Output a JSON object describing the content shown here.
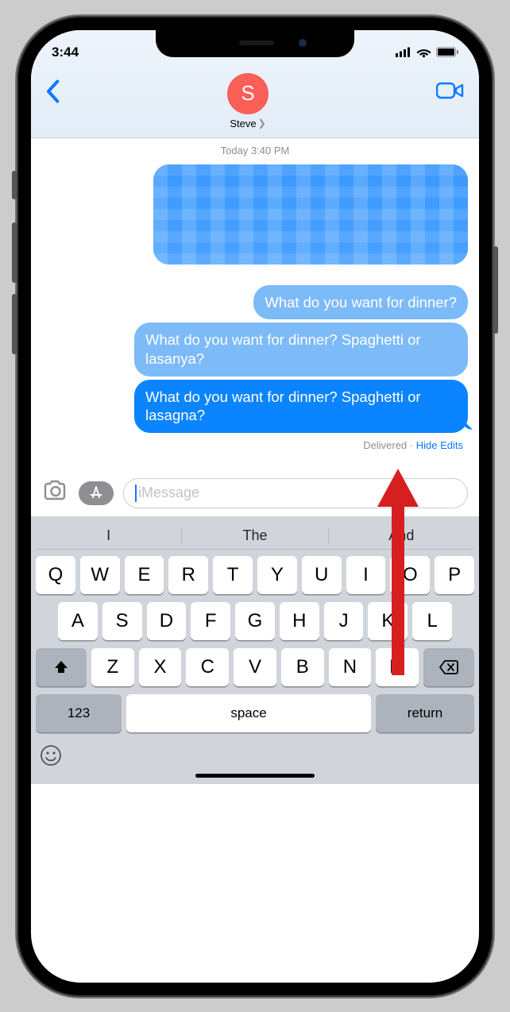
{
  "status": {
    "time": "3:44"
  },
  "header": {
    "contact_initial": "S",
    "contact_name": "Steve"
  },
  "conversation": {
    "timestamp": "Today 3:40 PM",
    "messages": [
      {
        "type": "redacted"
      },
      {
        "type": "edit_faded",
        "text": "What do you want for dinner?"
      },
      {
        "type": "edit_faded",
        "text": "What do you want for dinner? Spaghetti or lasanya?"
      },
      {
        "type": "sent",
        "text": "What do you want for dinner? Spaghetti or lasagna?"
      }
    ],
    "status_left": "Delivered",
    "status_action": "Hide Edits"
  },
  "composer": {
    "placeholder": "iMessage"
  },
  "keyboard": {
    "suggestions": [
      "I",
      "The",
      "And"
    ],
    "row1": [
      "Q",
      "W",
      "E",
      "R",
      "T",
      "Y",
      "U",
      "I",
      "O",
      "P"
    ],
    "row2": [
      "A",
      "S",
      "D",
      "F",
      "G",
      "H",
      "J",
      "K",
      "L"
    ],
    "row3": [
      "Z",
      "X",
      "C",
      "V",
      "B",
      "N",
      "M"
    ],
    "numbers_label": "123",
    "space_label": "space",
    "return_label": "return"
  }
}
